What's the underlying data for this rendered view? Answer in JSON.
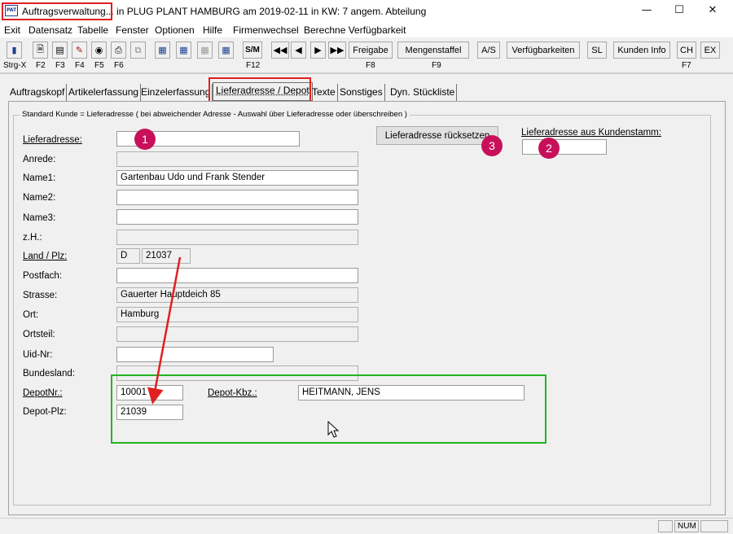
{
  "window": {
    "title": "Auftragsverwaltung... in PLUG PLANT HAMBURG am 2019-02-11 in KW: 7 angem. Abteilung",
    "app_icon_text": "PAT",
    "minimize_icon": "minimize-icon",
    "maximize_icon": "maximize-icon",
    "close_icon": "close-icon"
  },
  "menu": [
    "Exit",
    "Datensatz",
    "Tabelle",
    "Fenster",
    "Optionen",
    "Hilfe",
    "Firmenwechsel",
    "Berechne Verfügbarkeit"
  ],
  "toolbar": {
    "icon_buttons": [
      "door-exit-icon",
      "new-document-icon",
      "save-icon",
      "edit-pencil-icon",
      "binoculars-icon",
      "print-icon",
      "copy-icon",
      "calculator-icon",
      "calculator-next-icon",
      "calculator-disabled-icon",
      "calculator-edit-icon"
    ],
    "sm_label": "S/M",
    "nav_icons": [
      "first-record-icon",
      "previous-record-icon",
      "next-record-icon",
      "last-record-icon"
    ],
    "buttons": [
      "Freigabe",
      "Mengenstaffel",
      "A/S",
      "Verfügbarkeiten",
      "SL",
      "Kunden Info",
      "CH",
      "EX"
    ],
    "keys": [
      "Strg-X",
      "F2",
      "F3",
      "F4",
      "F5",
      "F6",
      "F12",
      "F8",
      "F9",
      "F7"
    ]
  },
  "tabs": [
    "Auftragskopf",
    "Artikelerfassung",
    "Einzelerfassung",
    "Lieferadresse / Depot",
    "Texte",
    "Sonstiges",
    "Dyn. Stückliste"
  ],
  "active_tab": "Lieferadresse / Depot",
  "group": {
    "legend": "Standard Kunde = Lieferadresse ( bei abweichender Adresse - Auswahl über Lieferadresse oder überschreiben )"
  },
  "form": {
    "lieferadresse_label": "Lieferadresse:",
    "lieferadresse_value": "",
    "anrede_label": "Anrede:",
    "anrede_value": "",
    "name1_label": "Name1:",
    "name1_value": "Gartenbau Udo und Frank Stender",
    "name2_label": "Name2:",
    "name2_value": "",
    "name3_label": "Name3:",
    "name3_value": "",
    "zh_label": "z.H.:",
    "zh_value": "",
    "land_plz_label": "Land / Plz:",
    "land_value": "D",
    "plz_value": "21037",
    "postfach_label": "Postfach:",
    "postfach_value": "",
    "strasse_label": "Strasse:",
    "strasse_value": "Gauerter Hauptdeich 85",
    "ort_label": "Ort:",
    "ort_value": "Hamburg",
    "ortsteil_label": "Ortsteil:",
    "ortsteil_value": "",
    "uid_label": "Uid-Nr:",
    "uid_value": "",
    "bundesland_label": "Bundesland:",
    "bundesland_value": "",
    "depotnr_label": "DepotNr.:",
    "depotnr_value": "10001",
    "depot_plz_label": "Depot-Plz:",
    "depot_plz_value": "21039",
    "depot_kbz_label": "Depot-Kbz.:",
    "depot_kbz_value": "HEITMANN, JENS",
    "reset_button": "Lieferadresse rücksetzen",
    "kundenstamm_label": "Lieferadresse aus Kundenstamm:",
    "kundenstamm_value": ""
  },
  "markers": [
    "1",
    "2",
    "3"
  ],
  "annotation_colors": {
    "highlight_red": "#e02020",
    "highlight_green": "#22b422",
    "marker_magenta": "#c8105a"
  },
  "statusbar": {
    "num": "NUM"
  }
}
